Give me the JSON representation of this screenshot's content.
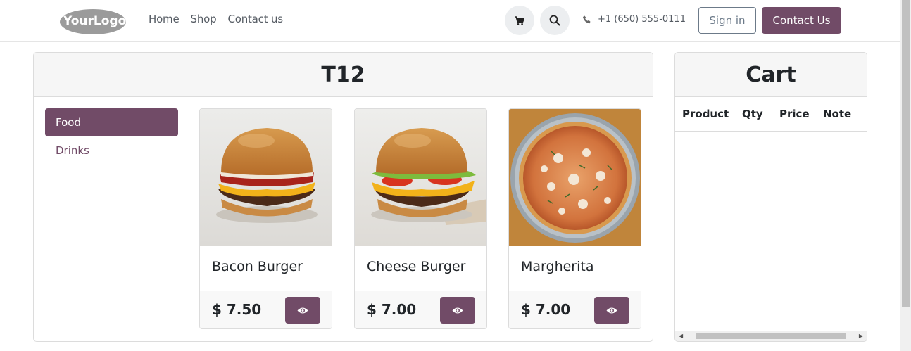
{
  "header": {
    "logo_text": "YourLogo",
    "nav": [
      "Home",
      "Shop",
      "Contact us"
    ],
    "phone": "+1 (650) 555-0111",
    "sign_in": "Sign in",
    "contact_button": "Contact Us"
  },
  "table": {
    "title": "T12",
    "categories": [
      {
        "label": "Food",
        "active": true
      },
      {
        "label": "Drinks",
        "active": false
      }
    ],
    "products": [
      {
        "name": "Bacon Burger",
        "price": "$ 7.50",
        "image": "bacon-burger"
      },
      {
        "name": "Cheese Burger",
        "price": "$ 7.00",
        "image": "cheese-burger"
      },
      {
        "name": "Margherita",
        "price": "$ 7.00",
        "image": "pizza"
      }
    ]
  },
  "cart": {
    "title": "Cart",
    "columns": [
      "Product",
      "Qty",
      "Price",
      "Note"
    ]
  },
  "colors": {
    "primary": "#714b67",
    "outline": "#6c7a89"
  }
}
